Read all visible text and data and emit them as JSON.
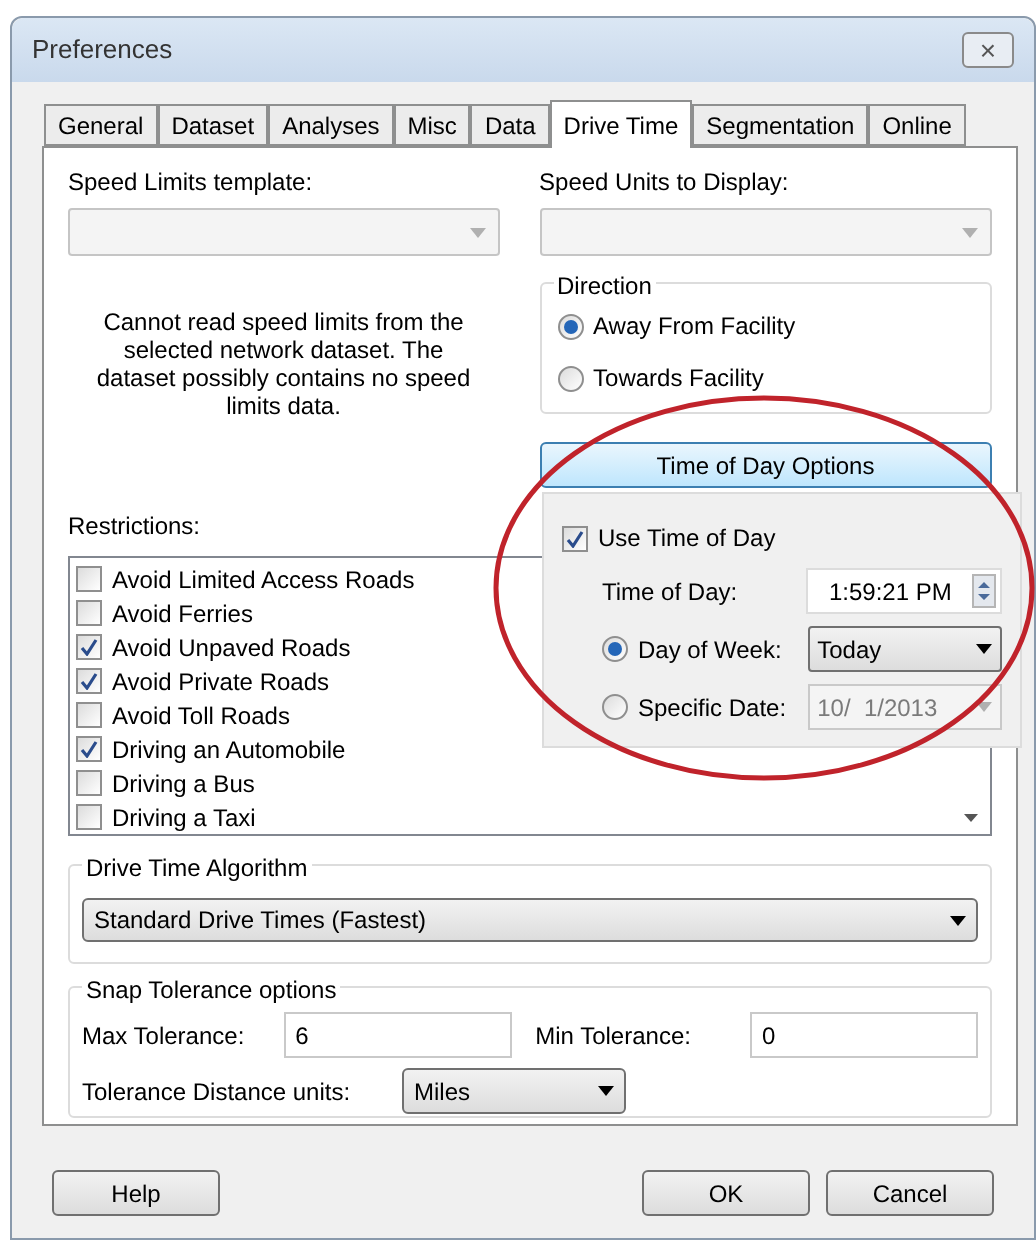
{
  "window": {
    "title": "Preferences",
    "close": "×"
  },
  "tabs": [
    {
      "label": "General",
      "selected": false
    },
    {
      "label": "Dataset",
      "selected": false
    },
    {
      "label": "Analyses",
      "selected": false
    },
    {
      "label": "Misc",
      "selected": false
    },
    {
      "label": "Data",
      "selected": false
    },
    {
      "label": "Drive Time",
      "selected": true
    },
    {
      "label": "Segmentation",
      "selected": false
    },
    {
      "label": "Online",
      "selected": false
    }
  ],
  "speed_limits": {
    "label": "Speed Limits template:",
    "message": "Cannot read speed limits from the selected network dataset. The dataset possibly contains no speed limits data."
  },
  "speed_units": {
    "label": "Speed Units to Display:"
  },
  "direction": {
    "title": "Direction",
    "options": [
      {
        "label": "Away From Facility",
        "selected": true
      },
      {
        "label": "Towards Facility",
        "selected": false
      }
    ]
  },
  "time_of_day_button": "Time of Day Options",
  "time_of_day": {
    "use": {
      "label": "Use Time of Day",
      "checked": true
    },
    "time_label": "Time of Day:",
    "time_value": "1:59:21 PM",
    "options": [
      {
        "label": "Day of Week:",
        "selected": true,
        "value": "Today",
        "disabled": false
      },
      {
        "label": "Specific Date:",
        "selected": false,
        "value": "10/  1/2013",
        "disabled": true
      }
    ]
  },
  "restrictions": {
    "label": "Restrictions:",
    "items": [
      {
        "label": "Avoid Limited Access Roads",
        "checked": false
      },
      {
        "label": "Avoid Ferries",
        "checked": false
      },
      {
        "label": "Avoid Unpaved Roads",
        "checked": true
      },
      {
        "label": "Avoid Private Roads",
        "checked": true
      },
      {
        "label": "Avoid Toll Roads",
        "checked": false
      },
      {
        "label": "Driving an Automobile",
        "checked": true
      },
      {
        "label": "Driving a Bus",
        "checked": false
      },
      {
        "label": "Driving a Taxi",
        "checked": false
      }
    ]
  },
  "algorithm": {
    "title": "Drive Time Algorithm",
    "value": "Standard Drive Times (Fastest)"
  },
  "snap": {
    "title": "Snap Tolerance options",
    "max_label": "Max Tolerance:",
    "max_value": "6",
    "min_label": "Min Tolerance:",
    "min_value": "0",
    "units_label": "Tolerance Distance units:",
    "units_value": "Miles"
  },
  "buttons": [
    "Help",
    "OK",
    "Cancel"
  ]
}
